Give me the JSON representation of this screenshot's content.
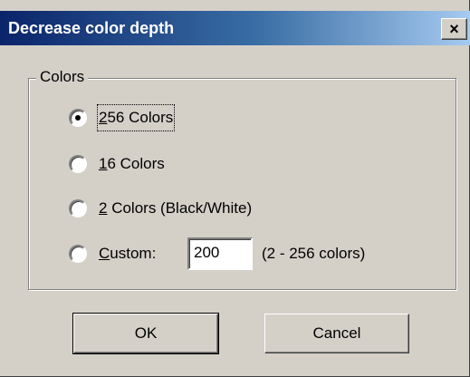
{
  "window": {
    "title": "Decrease color depth",
    "close_label": "×"
  },
  "colors_group": {
    "label": "Colors",
    "options": [
      {
        "label": "256 Colors",
        "mnemonic": "2",
        "rest": "56 Colors",
        "selected": true
      },
      {
        "label": "16 Colors",
        "mnemonic": "1",
        "rest": "6 Colors",
        "selected": false
      },
      {
        "label": "2 Colors (Black/White)",
        "mnemonic": "2",
        "rest": " Colors (Black/White)",
        "selected": false
      },
      {
        "label": "Custom:",
        "mnemonic": "C",
        "rest": "ustom:",
        "selected": false
      }
    ],
    "custom_value": "200",
    "custom_range": "(2 - 256 colors)"
  },
  "buttons": {
    "ok": "OK",
    "cancel": "Cancel"
  },
  "colors": {
    "title_gradient_start": "#0a246a",
    "title_gradient_end": "#a6caf0",
    "face": "#d4d0c8"
  }
}
